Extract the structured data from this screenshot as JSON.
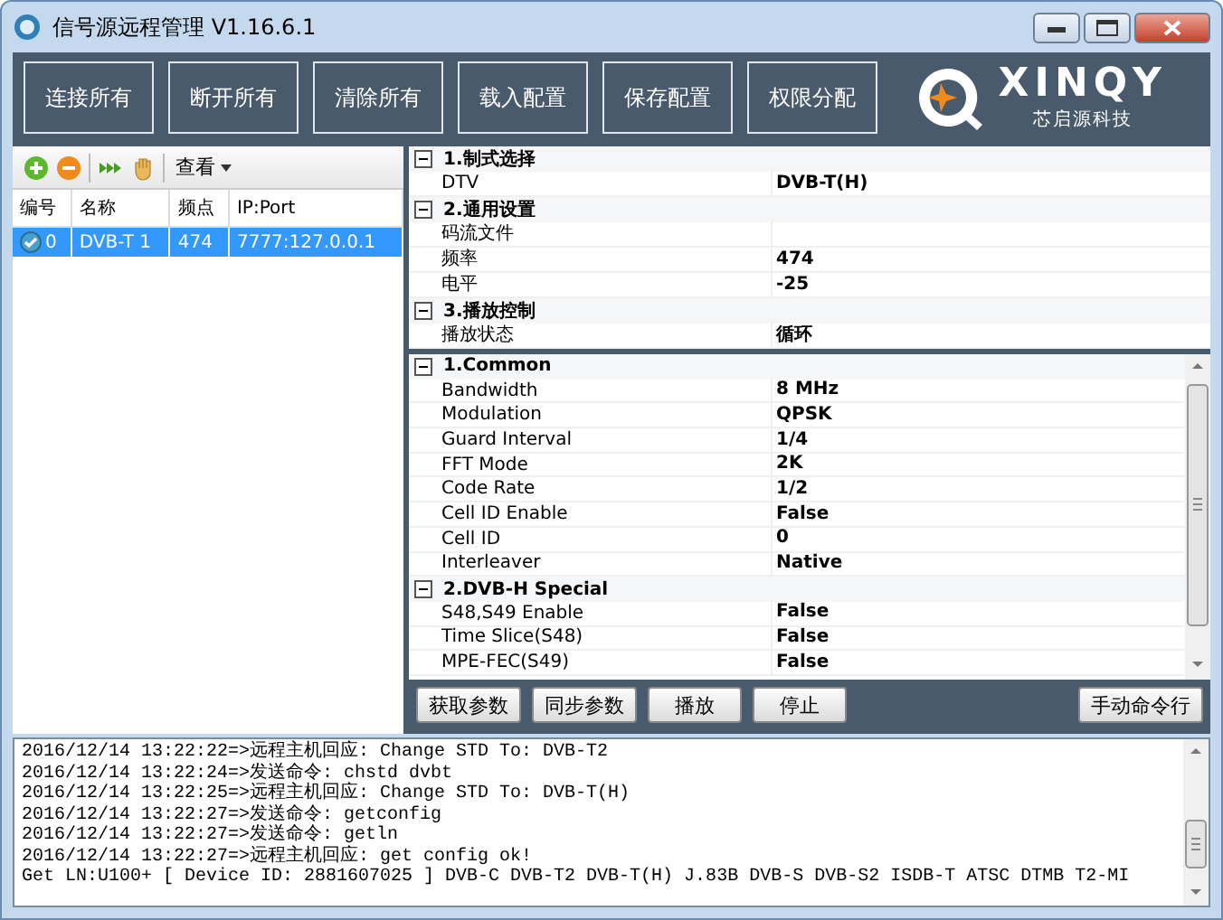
{
  "window": {
    "title": "信号源远程管理 V1.16.6.1"
  },
  "toolbar": {
    "buttons": [
      "连接所有",
      "断开所有",
      "清除所有",
      "载入配置",
      "保存配置",
      "权限分配"
    ]
  },
  "logo": {
    "name": "XINQY",
    "subtitle": "芯启源科技"
  },
  "device_panel": {
    "view_menu": "查看",
    "columns": [
      "编号",
      "名称",
      "频点",
      "IP:Port"
    ],
    "rows": [
      {
        "cells": [
          "0",
          "DVB-T 1",
          "474",
          "7777:127.0.0.1"
        ],
        "selected": true
      }
    ]
  },
  "general_grid": {
    "sections": [
      {
        "title": "1.制式选择",
        "expanded": true,
        "rows": [
          {
            "name": "DTV",
            "value": "DVB-T(H)"
          }
        ]
      },
      {
        "title": "2.通用设置",
        "expanded": true,
        "rows": [
          {
            "name": "码流文件",
            "value": ""
          },
          {
            "name": "频率",
            "value": "474"
          },
          {
            "name": "电平",
            "value": "-25"
          }
        ]
      },
      {
        "title": "3.播放控制",
        "expanded": true,
        "rows": [
          {
            "name": "播放状态",
            "value": "循环"
          }
        ]
      }
    ]
  },
  "mode_grid": {
    "sections": [
      {
        "title": "1.Common",
        "expanded": true,
        "rows": [
          {
            "name": "Bandwidth",
            "value": "8 MHz"
          },
          {
            "name": "Modulation",
            "value": "QPSK"
          },
          {
            "name": "Guard Interval",
            "value": "1/4"
          },
          {
            "name": "FFT Mode",
            "value": "2K"
          },
          {
            "name": "Code Rate",
            "value": "1/2"
          },
          {
            "name": "Cell ID Enable",
            "value": "False"
          },
          {
            "name": "Cell ID",
            "value": "0"
          },
          {
            "name": "Interleaver",
            "value": "Native"
          }
        ]
      },
      {
        "title": "2.DVB-H Special",
        "expanded": true,
        "rows": [
          {
            "name": "S48,S49 Enable",
            "value": "False"
          },
          {
            "name": "Time Slice(S48)",
            "value": "False"
          },
          {
            "name": "MPE-FEC(S49)",
            "value": "False"
          }
        ]
      }
    ]
  },
  "action_buttons": [
    "获取参数",
    "同步参数",
    "播放",
    "停止"
  ],
  "command_button": "手动命令行",
  "log": [
    "2016/12/14 13:22:22=>远程主机回应: Change STD To: DVB-T2",
    "2016/12/14 13:22:24=>发送命令: chstd dvbt",
    "2016/12/14 13:22:25=>远程主机回应: Change STD To: DVB-T(H)",
    "2016/12/14 13:22:27=>发送命令: getconfig",
    "2016/12/14 13:22:27=>发送命令: getln",
    "2016/12/14 13:22:27=>远程主机回应: get config ok!",
    "Get LN:U100+ [ Device ID: 2881607025 ] DVB-C DVB-T2 DVB-T(H) J.83B DVB-S DVB-S2 ISDB-T ATSC DTMB T2-MI"
  ]
}
